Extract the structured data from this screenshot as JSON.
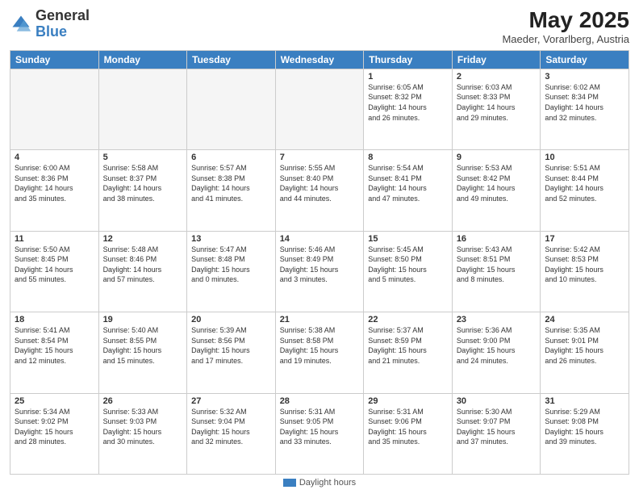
{
  "header": {
    "logo_general": "General",
    "logo_blue": "Blue",
    "month_title": "May 2025",
    "location": "Maeder, Vorarlberg, Austria"
  },
  "weekdays": [
    "Sunday",
    "Monday",
    "Tuesday",
    "Wednesday",
    "Thursday",
    "Friday",
    "Saturday"
  ],
  "footer_label": "Daylight hours",
  "weeks": [
    [
      {
        "day": "",
        "info": "",
        "empty": true
      },
      {
        "day": "",
        "info": "",
        "empty": true
      },
      {
        "day": "",
        "info": "",
        "empty": true
      },
      {
        "day": "",
        "info": "",
        "empty": true
      },
      {
        "day": "1",
        "info": "Sunrise: 6:05 AM\nSunset: 8:32 PM\nDaylight: 14 hours\nand 26 minutes."
      },
      {
        "day": "2",
        "info": "Sunrise: 6:03 AM\nSunset: 8:33 PM\nDaylight: 14 hours\nand 29 minutes."
      },
      {
        "day": "3",
        "info": "Sunrise: 6:02 AM\nSunset: 8:34 PM\nDaylight: 14 hours\nand 32 minutes."
      }
    ],
    [
      {
        "day": "4",
        "info": "Sunrise: 6:00 AM\nSunset: 8:36 PM\nDaylight: 14 hours\nand 35 minutes."
      },
      {
        "day": "5",
        "info": "Sunrise: 5:58 AM\nSunset: 8:37 PM\nDaylight: 14 hours\nand 38 minutes."
      },
      {
        "day": "6",
        "info": "Sunrise: 5:57 AM\nSunset: 8:38 PM\nDaylight: 14 hours\nand 41 minutes."
      },
      {
        "day": "7",
        "info": "Sunrise: 5:55 AM\nSunset: 8:40 PM\nDaylight: 14 hours\nand 44 minutes."
      },
      {
        "day": "8",
        "info": "Sunrise: 5:54 AM\nSunset: 8:41 PM\nDaylight: 14 hours\nand 47 minutes."
      },
      {
        "day": "9",
        "info": "Sunrise: 5:53 AM\nSunset: 8:42 PM\nDaylight: 14 hours\nand 49 minutes."
      },
      {
        "day": "10",
        "info": "Sunrise: 5:51 AM\nSunset: 8:44 PM\nDaylight: 14 hours\nand 52 minutes."
      }
    ],
    [
      {
        "day": "11",
        "info": "Sunrise: 5:50 AM\nSunset: 8:45 PM\nDaylight: 14 hours\nand 55 minutes."
      },
      {
        "day": "12",
        "info": "Sunrise: 5:48 AM\nSunset: 8:46 PM\nDaylight: 14 hours\nand 57 minutes."
      },
      {
        "day": "13",
        "info": "Sunrise: 5:47 AM\nSunset: 8:48 PM\nDaylight: 15 hours\nand 0 minutes."
      },
      {
        "day": "14",
        "info": "Sunrise: 5:46 AM\nSunset: 8:49 PM\nDaylight: 15 hours\nand 3 minutes."
      },
      {
        "day": "15",
        "info": "Sunrise: 5:45 AM\nSunset: 8:50 PM\nDaylight: 15 hours\nand 5 minutes."
      },
      {
        "day": "16",
        "info": "Sunrise: 5:43 AM\nSunset: 8:51 PM\nDaylight: 15 hours\nand 8 minutes."
      },
      {
        "day": "17",
        "info": "Sunrise: 5:42 AM\nSunset: 8:53 PM\nDaylight: 15 hours\nand 10 minutes."
      }
    ],
    [
      {
        "day": "18",
        "info": "Sunrise: 5:41 AM\nSunset: 8:54 PM\nDaylight: 15 hours\nand 12 minutes."
      },
      {
        "day": "19",
        "info": "Sunrise: 5:40 AM\nSunset: 8:55 PM\nDaylight: 15 hours\nand 15 minutes."
      },
      {
        "day": "20",
        "info": "Sunrise: 5:39 AM\nSunset: 8:56 PM\nDaylight: 15 hours\nand 17 minutes."
      },
      {
        "day": "21",
        "info": "Sunrise: 5:38 AM\nSunset: 8:58 PM\nDaylight: 15 hours\nand 19 minutes."
      },
      {
        "day": "22",
        "info": "Sunrise: 5:37 AM\nSunset: 8:59 PM\nDaylight: 15 hours\nand 21 minutes."
      },
      {
        "day": "23",
        "info": "Sunrise: 5:36 AM\nSunset: 9:00 PM\nDaylight: 15 hours\nand 24 minutes."
      },
      {
        "day": "24",
        "info": "Sunrise: 5:35 AM\nSunset: 9:01 PM\nDaylight: 15 hours\nand 26 minutes."
      }
    ],
    [
      {
        "day": "25",
        "info": "Sunrise: 5:34 AM\nSunset: 9:02 PM\nDaylight: 15 hours\nand 28 minutes."
      },
      {
        "day": "26",
        "info": "Sunrise: 5:33 AM\nSunset: 9:03 PM\nDaylight: 15 hours\nand 30 minutes."
      },
      {
        "day": "27",
        "info": "Sunrise: 5:32 AM\nSunset: 9:04 PM\nDaylight: 15 hours\nand 32 minutes."
      },
      {
        "day": "28",
        "info": "Sunrise: 5:31 AM\nSunset: 9:05 PM\nDaylight: 15 hours\nand 33 minutes."
      },
      {
        "day": "29",
        "info": "Sunrise: 5:31 AM\nSunset: 9:06 PM\nDaylight: 15 hours\nand 35 minutes."
      },
      {
        "day": "30",
        "info": "Sunrise: 5:30 AM\nSunset: 9:07 PM\nDaylight: 15 hours\nand 37 minutes."
      },
      {
        "day": "31",
        "info": "Sunrise: 5:29 AM\nSunset: 9:08 PM\nDaylight: 15 hours\nand 39 minutes."
      }
    ]
  ]
}
